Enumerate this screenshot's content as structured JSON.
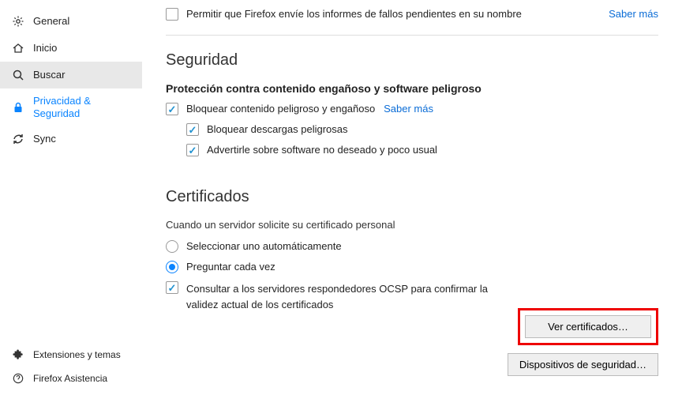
{
  "sidebar": {
    "items": [
      {
        "label": "General"
      },
      {
        "label": "Inicio"
      },
      {
        "label": "Buscar"
      },
      {
        "label": "Privacidad & Seguridad"
      },
      {
        "label": "Sync"
      }
    ],
    "bottom": [
      {
        "label": "Extensiones y temas"
      },
      {
        "label": "Firefox Asistencia"
      }
    ]
  },
  "crash": {
    "label": "Permitir que Firefox envíe los informes de fallos pendientes en su nombre",
    "more": "Saber más"
  },
  "security": {
    "heading": "Seguridad",
    "subheading": "Protección contra contenido engañoso y software peligroso",
    "block_label": "Bloquear contenido peligroso y engañoso",
    "more": "Saber más",
    "downloads_label": "Bloquear descargas peligrosas",
    "warn_label": "Advertirle sobre software no deseado y poco usual"
  },
  "certs": {
    "heading": "Certificados",
    "desc": "Cuando un servidor solicite su certificado personal",
    "radio_auto": "Seleccionar uno automáticamente",
    "radio_ask": "Preguntar cada vez",
    "ocsp_label": "Consultar a los servidores respondedores OCSP para confirmar la validez actual de los certificados",
    "view_btn": "Ver certificados…",
    "devices_btn": "Dispositivos de seguridad…"
  }
}
